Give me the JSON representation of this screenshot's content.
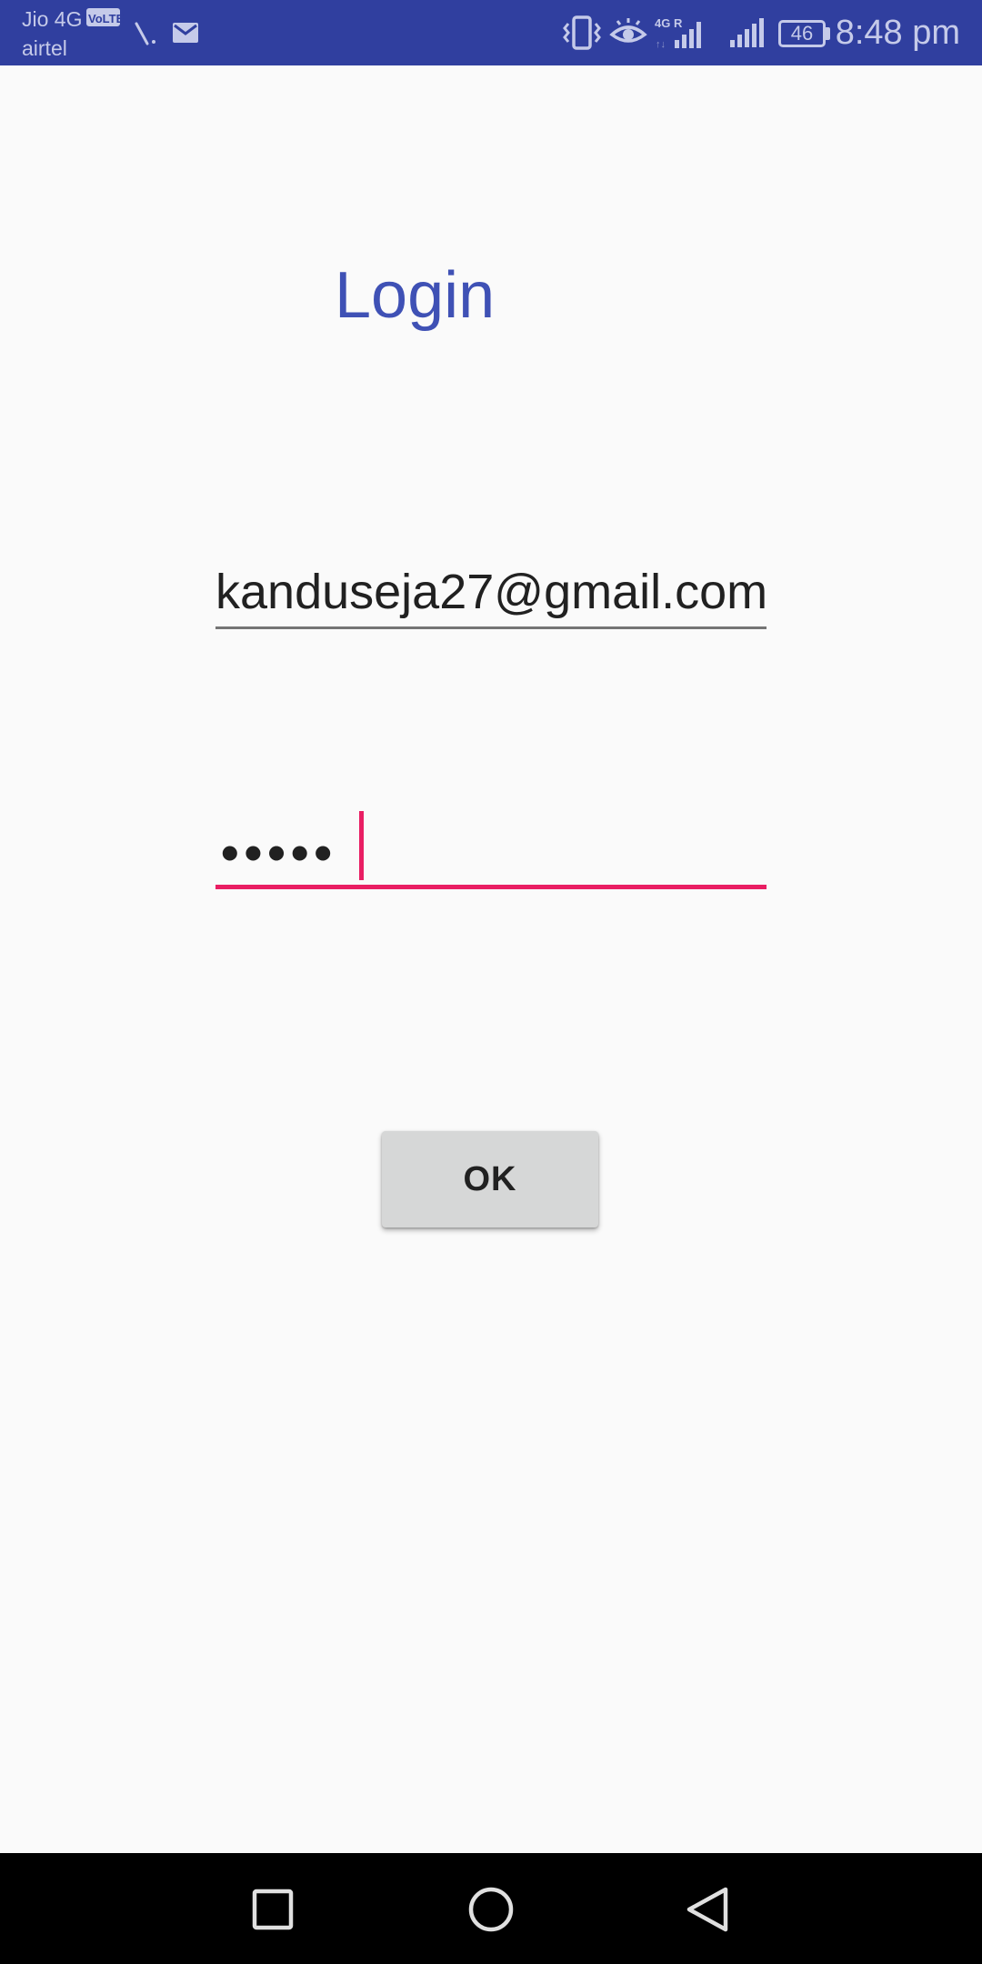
{
  "status_bar": {
    "carrier_primary": "Jio 4G",
    "volte_badge": "VoLTE",
    "carrier_secondary": "airtel",
    "network_badge": "4G R",
    "battery_level": "46",
    "time": "8:48 pm",
    "icons": [
      "wifi-calling-icon",
      "gmail-icon",
      "vibrate-icon",
      "eye-comfort-icon",
      "signal-4g-icon",
      "signal-icon",
      "battery-icon"
    ],
    "color": "#303f9f"
  },
  "login": {
    "title": "Login",
    "email_value": "kanduseja27@gmail.com",
    "password_mask": "•••••",
    "ok_label": "OK",
    "accent_color": "#3f51b5",
    "focus_color": "#e91e63"
  },
  "nav_bar": {
    "icons": [
      "recents-icon",
      "home-icon",
      "back-icon"
    ]
  }
}
